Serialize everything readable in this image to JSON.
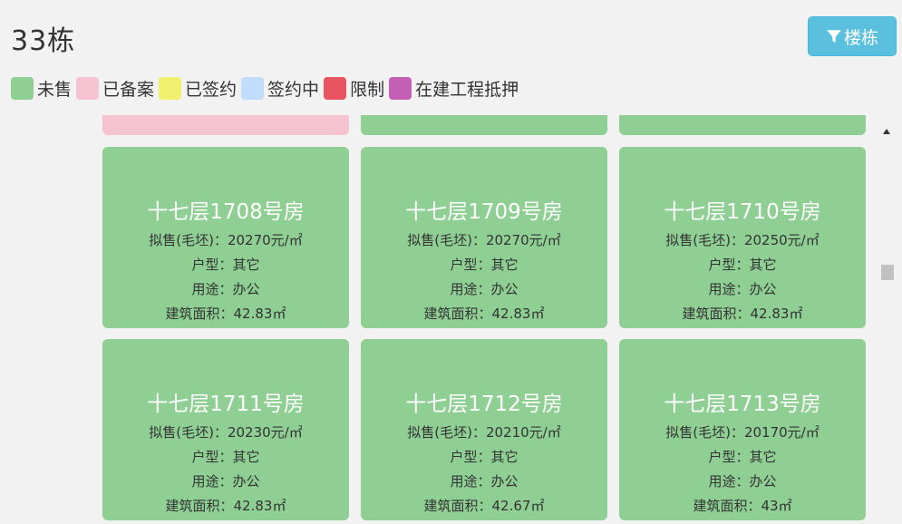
{
  "header": {
    "title": "33栋",
    "filter_label": "楼栋"
  },
  "legend": [
    {
      "label": "未售",
      "color": "#8fcf93"
    },
    {
      "label": "已备案",
      "color": "#f6c3d0"
    },
    {
      "label": "已签约",
      "color": "#f1f06e"
    },
    {
      "label": "签约中",
      "color": "#c2dcfb"
    },
    {
      "label": "限制",
      "color": "#e8545f"
    },
    {
      "label": "在建工程抵押",
      "color": "#c35fb4"
    }
  ],
  "colors": {
    "unsold": "#8fcf93",
    "filed": "#f6c3d0",
    "accent": "#5bc0de"
  },
  "cards": [
    {
      "room": "十七层1708号房",
      "price": "拟售(毛坯)：20270元/㎡",
      "type": "户型：其它",
      "use": "用途：办公",
      "area": "建筑面积：42.83㎡"
    },
    {
      "room": "十七层1709号房",
      "price": "拟售(毛坯)：20270元/㎡",
      "type": "户型：其它",
      "use": "用途：办公",
      "area": "建筑面积：42.83㎡"
    },
    {
      "room": "十七层1710号房",
      "price": "拟售(毛坯)：20250元/㎡",
      "type": "户型：其它",
      "use": "用途：办公",
      "area": "建筑面积：42.83㎡"
    },
    {
      "room": "十七层1711号房",
      "price": "拟售(毛坯)：20230元/㎡",
      "type": "户型：其它",
      "use": "用途：办公",
      "area": "建筑面积：42.83㎡"
    },
    {
      "room": "十七层1712号房",
      "price": "拟售(毛坯)：20210元/㎡",
      "type": "户型：其它",
      "use": "用途：办公",
      "area": "建筑面积：42.67㎡"
    },
    {
      "room": "十七层1713号房",
      "price": "拟售(毛坯)：20170元/㎡",
      "type": "户型：其它",
      "use": "用途：办公",
      "area": "建筑面积：43㎡"
    }
  ]
}
